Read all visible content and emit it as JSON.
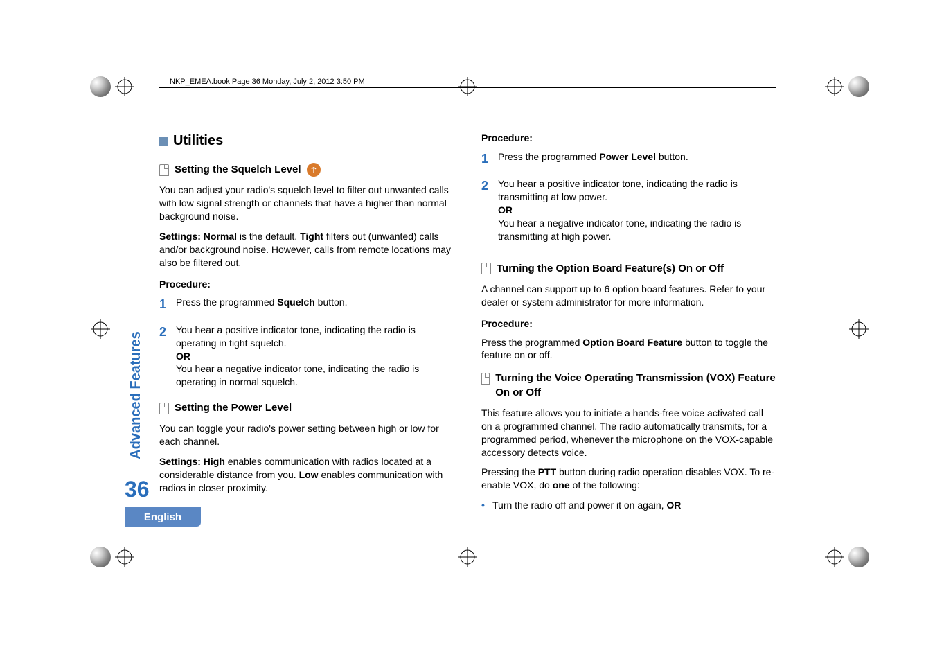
{
  "header": {
    "running_head": "NKP_EMEA.book  Page 36  Monday, July 2, 2012  3:50 PM"
  },
  "side": {
    "tab_label": "Advanced Features",
    "page_number": "36",
    "language": "English"
  },
  "left": {
    "section_heading": "Utilities",
    "sub1": {
      "title": "Setting the Squelch Level",
      "icon_name": "antenna-icon",
      "p1a": "You can adjust your radio's squelch level to filter out unwanted calls with low signal strength or channels that have a higher than normal background noise.",
      "p2_prefix": "Settings: Normal",
      "p2_mid1": " is the default. ",
      "p2_tight": "Tight",
      "p2_mid2": " filters out (unwanted) calls and/or background noise. However, calls from remote locations may also be filtered out.",
      "proc_label": "Procedure:",
      "step1_pre": "Press the programmed ",
      "step1_b": "Squelch",
      "step1_post": " button.",
      "step2_line1": "You hear a positive indicator tone, indicating the radio is operating in tight squelch.",
      "step2_or": "OR",
      "step2_line2": "You hear a negative indicator tone, indicating the radio is operating in normal squelch."
    },
    "sub2": {
      "title": "Setting the Power Level",
      "p1": "You can toggle your radio's power setting between high or low for each channel.",
      "p2_prefix": "Settings:  High",
      "p2_mid1": " enables communication with radios located at a considerable distance from you. ",
      "p2_low": "Low",
      "p2_mid2": " enables communication with radios in closer proximity."
    }
  },
  "right": {
    "proc_label": "Procedure:",
    "step1_pre": "Press the programmed ",
    "step1_b": "Power Level",
    "step1_post": " button.",
    "step2_line1": "You hear a positive indicator tone, indicating the radio is transmitting at low power.",
    "step2_or": "OR",
    "step2_line2": "You hear a negative indicator tone, indicating the radio is transmitting at high power.",
    "sub3": {
      "title": "Turning the Option Board Feature(s) On or Off",
      "p1": "A channel can support up to 6 option board features. Refer to your dealer or system administrator for more information.",
      "proc_label": "Procedure:",
      "p2_pre": "Press the programmed ",
      "p2_b": "Option Board Feature",
      "p2_post": " button to toggle the feature on or off."
    },
    "sub4": {
      "title": "Turning the Voice Operating Transmission (VOX) Feature On or Off",
      "p1": "This feature allows you to initiate a hands-free voice activated call on a programmed channel. The radio automatically transmits, for a programmed period, whenever the microphone on the VOX-capable accessory detects voice.",
      "p2_pre": "Pressing the ",
      "p2_ptt": "PTT",
      "p2_mid": " button during radio operation disables VOX. To re-enable VOX, do ",
      "p2_one": "one",
      "p2_post": " of the following:",
      "bullet1_pre": "Turn the radio off and power it on again, ",
      "bullet1_or": "OR"
    }
  }
}
